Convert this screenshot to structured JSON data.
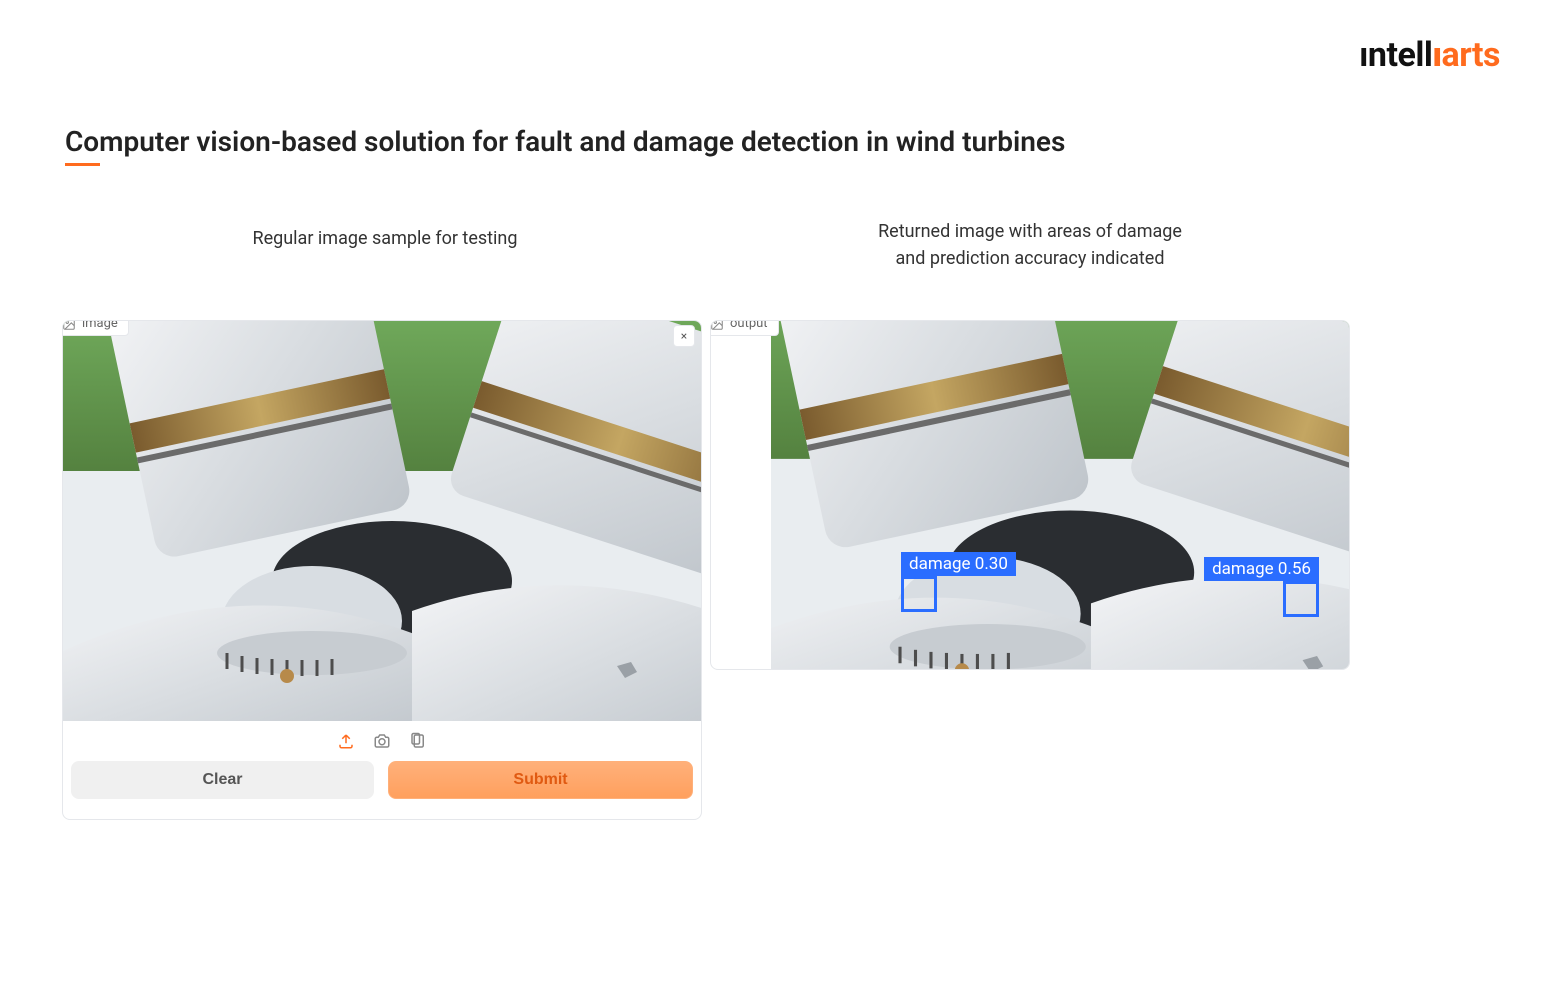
{
  "logo": {
    "prefix": "ıntell",
    "dotted_i": "ı",
    "suffix": "arts"
  },
  "title": "Computer vision-based solution for fault and damage detection in wind turbines",
  "captions": {
    "left": "Regular image sample for testing",
    "right": "Returned image with areas of damage\nand prediction accuracy indicated"
  },
  "left_panel": {
    "tag": "image",
    "close_tooltip": "×",
    "toolbar": {
      "upload_icon": "upload",
      "camera_icon": "camera",
      "paste_icon": "clipboard"
    },
    "buttons": {
      "clear": "Clear",
      "submit": "Submit"
    }
  },
  "right_panel": {
    "tag": "output",
    "controls": {
      "expand_tooltip": "⤢",
      "download_tooltip": "⭳",
      "share_tooltip": "⇪"
    },
    "detections": [
      {
        "label": "damage",
        "score": 0.3,
        "text": "damage  0.30"
      },
      {
        "label": "damage",
        "score": 0.56,
        "text": "damage  0.56"
      }
    ]
  }
}
